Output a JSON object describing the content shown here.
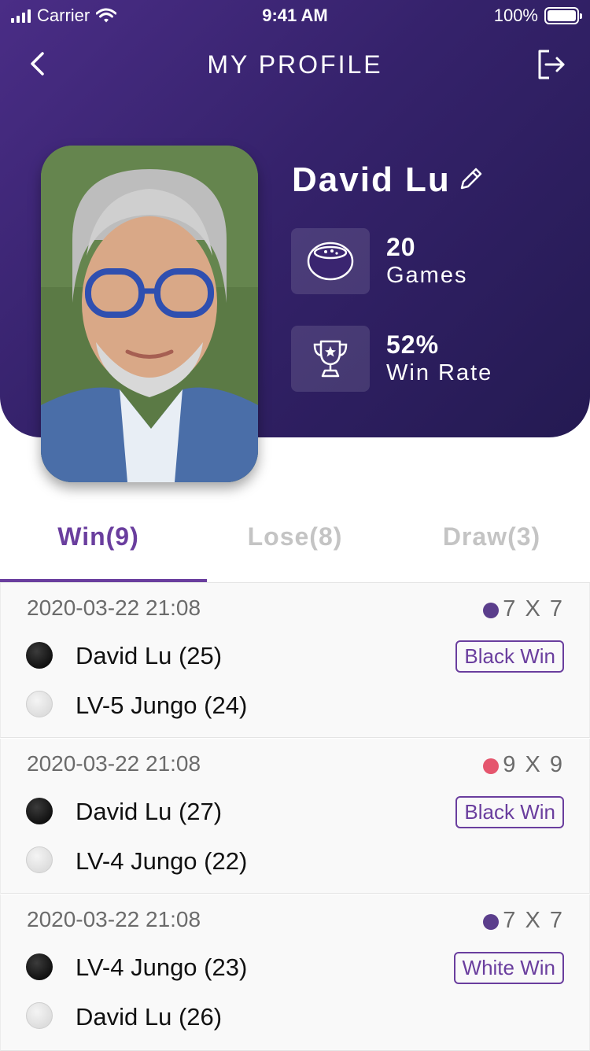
{
  "status_bar": {
    "carrier": "Carrier",
    "time": "9:41 AM",
    "battery": "100%"
  },
  "nav": {
    "title": "MY PROFILE",
    "back_icon": "chevron-left-icon",
    "logout_icon": "logout-icon"
  },
  "profile": {
    "name": "David Lu",
    "edit_icon": "pencil-icon",
    "stats": [
      {
        "icon": "go-bowl-icon",
        "value": "20",
        "label": "Games"
      },
      {
        "icon": "trophy-icon",
        "value": "52%",
        "label": "Win Rate"
      }
    ]
  },
  "tabs": [
    {
      "label": "Win(9)",
      "active": true
    },
    {
      "label": "Lose(8)",
      "active": false
    },
    {
      "label": "Draw(3)",
      "active": false
    }
  ],
  "games": [
    {
      "date": "2020-03-22 21:08",
      "board": "7 X 7",
      "board_color": "#5b3e8c",
      "black_player": "David Lu (25)",
      "white_player": "LV-5 Jungo (24)",
      "result": "Black Win"
    },
    {
      "date": "2020-03-22 21:08",
      "board": "9 X 9",
      "board_color": "#e5566e",
      "black_player": "David Lu (27)",
      "white_player": "LV-4 Jungo (22)",
      "result": "Black Win"
    },
    {
      "date": "2020-03-22 21:08",
      "board": "7 X 7",
      "board_color": "#5b3e8c",
      "black_player": "LV-4 Jungo (23)",
      "white_player": "David Lu (26)",
      "result": "White Win"
    }
  ],
  "colors": {
    "brand": "#4a2d86",
    "accent": "#6a3e9e",
    "tab_inactive": "#c4c4c4"
  }
}
